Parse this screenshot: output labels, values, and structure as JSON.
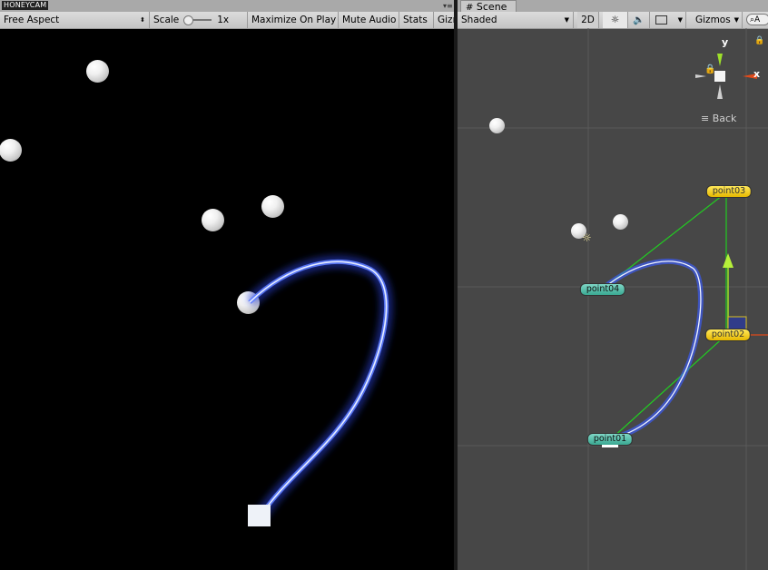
{
  "watermark": "HONEYCAM",
  "game_view": {
    "aspect_label": "Free Aspect",
    "scale_label": "Scale",
    "scale_value": "1x",
    "maximize_label": "Maximize On Play",
    "mute_label": "Mute Audio",
    "stats_label": "Stats",
    "gizmos_label": "Gizm"
  },
  "scene_view": {
    "tab_label": "Scene",
    "shading_label": "Shaded",
    "mode_2d_label": "2D",
    "gizmos_label": "Gizmos",
    "search_label": "A",
    "axis_y": "y",
    "axis_x": "x",
    "back_label": "Back",
    "points": [
      {
        "name": "point03",
        "color": "yellow"
      },
      {
        "name": "point04",
        "color": "teal"
      },
      {
        "name": "point02",
        "color": "yellow"
      },
      {
        "name": "point01",
        "color": "teal"
      }
    ]
  },
  "colors": {
    "game_background": "#000000",
    "scene_background": "#474747",
    "trail_glow": "#3a5cff",
    "handle_line": "#22cc22",
    "axis_x_color": "#e04a1a",
    "axis_y_color": "#9ee02a"
  }
}
